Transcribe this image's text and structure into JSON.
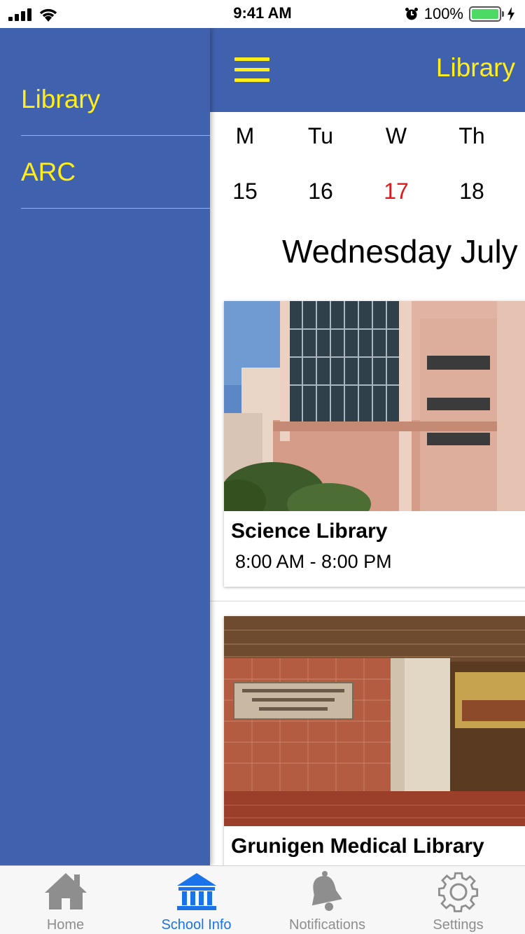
{
  "status_bar": {
    "time": "9:41 AM",
    "battery_percent": "100%"
  },
  "side_menu": {
    "items": [
      {
        "label": "Library"
      },
      {
        "label": "ARC"
      }
    ]
  },
  "nav": {
    "title": "Library"
  },
  "calendar": {
    "day_names": [
      "M",
      "Tu",
      "W",
      "Th"
    ],
    "day_numbers": [
      "15",
      "16",
      "17",
      "18"
    ],
    "selected_day": "17",
    "heading": "Wednesday July"
  },
  "libraries": [
    {
      "name": "Science Library",
      "hours": "8:00 AM - 8:00 PM"
    },
    {
      "name": "Grunigen Medical Library"
    }
  ],
  "tab_bar": {
    "tabs": [
      {
        "label": "Home",
        "icon": "house-icon"
      },
      {
        "label": "School Info",
        "icon": "building-columns-icon"
      },
      {
        "label": "Notifications",
        "icon": "bell-icon"
      },
      {
        "label": "Settings",
        "icon": "gear-icon"
      }
    ],
    "active_index": 1
  },
  "colors": {
    "primary_blue": "#4062ae",
    "accent_yellow": "#ffee1a",
    "today_red": "#e0191c",
    "active_tab_blue": "#1a73e8"
  }
}
